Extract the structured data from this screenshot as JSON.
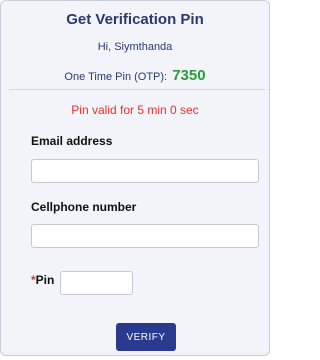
{
  "header": {
    "title": "Get Verification Pin",
    "greeting": "Hi, Siymthanda",
    "otp_label": "One Time Pin (OTP):",
    "otp_value": "7350"
  },
  "validity_text": "Pin valid for 5 min 0 sec",
  "form": {
    "email_label": "Email address",
    "email_value": "",
    "cellphone_label": "Cellphone number",
    "cellphone_value": "",
    "pin_required_mark": "*",
    "pin_label": "Pin",
    "pin_value": ""
  },
  "verify_button_label": "VERIFY",
  "colors": {
    "title": "#2b3a6b",
    "otp_value": "#2b9a3a",
    "validity": "#e0322e",
    "button": "#2a3a8e"
  }
}
